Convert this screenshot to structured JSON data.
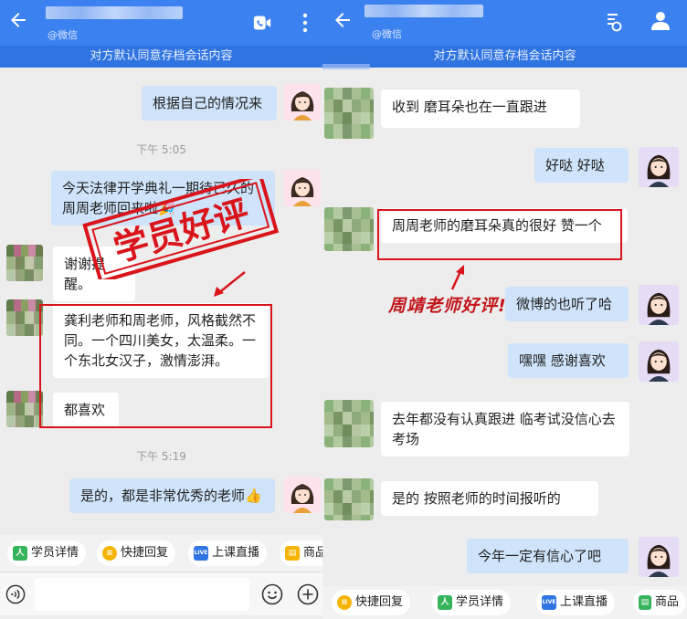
{
  "left": {
    "header": {
      "sub_label": "@微信"
    },
    "banner": "对方默认同意存档会话内容",
    "messages": [
      {
        "side": "out",
        "text": "根据自己的情况来"
      },
      {
        "side": "time",
        "text": "下午 5:05"
      },
      {
        "side": "out",
        "text": "今天法律开学典礼一期待已久的周周老师回来啦🎉"
      },
      {
        "side": "in",
        "text": "谢谢提醒。"
      },
      {
        "side": "in",
        "text": "龚利老师和周老师，风格截然不同。一个四川美女，太温柔。一个东北女汉子，激情澎湃。"
      },
      {
        "side": "in",
        "text": "都喜欢"
      },
      {
        "side": "time",
        "text": "下午 5:19"
      },
      {
        "side": "out",
        "text": "是的，都是非常优秀的老师👍"
      }
    ],
    "stamp_text": "学员好评",
    "quick_actions": [
      "学员详情",
      "快捷回复",
      "上课直播",
      "商品"
    ]
  },
  "right": {
    "header": {
      "sub_label": "@微信"
    },
    "banner": "对方默认同意存档会话内容",
    "messages": [
      {
        "side": "in",
        "text": "收到 磨耳朵也在一直跟进"
      },
      {
        "side": "out",
        "text": "好哒 好哒"
      },
      {
        "side": "in",
        "text": "周周老师的磨耳朵真的很好 赞一个"
      },
      {
        "side": "out",
        "text": "微博的也听了哈"
      },
      {
        "side": "out",
        "text": "嘿嘿 感谢喜欢"
      },
      {
        "side": "in",
        "text": "去年都没有认真跟进 临考试没信心去考场"
      },
      {
        "side": "in",
        "text": "是的 按照老师的时间报听的"
      },
      {
        "side": "out",
        "text": "今年一定有信心了吧"
      }
    ],
    "caption": "周靖老师好评!",
    "quick_actions": [
      "快捷回复",
      "学员详情",
      "上课直播",
      "商品"
    ]
  },
  "colors": {
    "header_blue": "#3b82f0",
    "bubble_out": "#cfe4fb",
    "highlight_red": "#d9151b"
  },
  "icons": [
    "back-arrow-icon",
    "video-call-icon",
    "more-vertical-icon",
    "profile-icon",
    "voice-icon",
    "emoji-icon",
    "plus-icon"
  ]
}
